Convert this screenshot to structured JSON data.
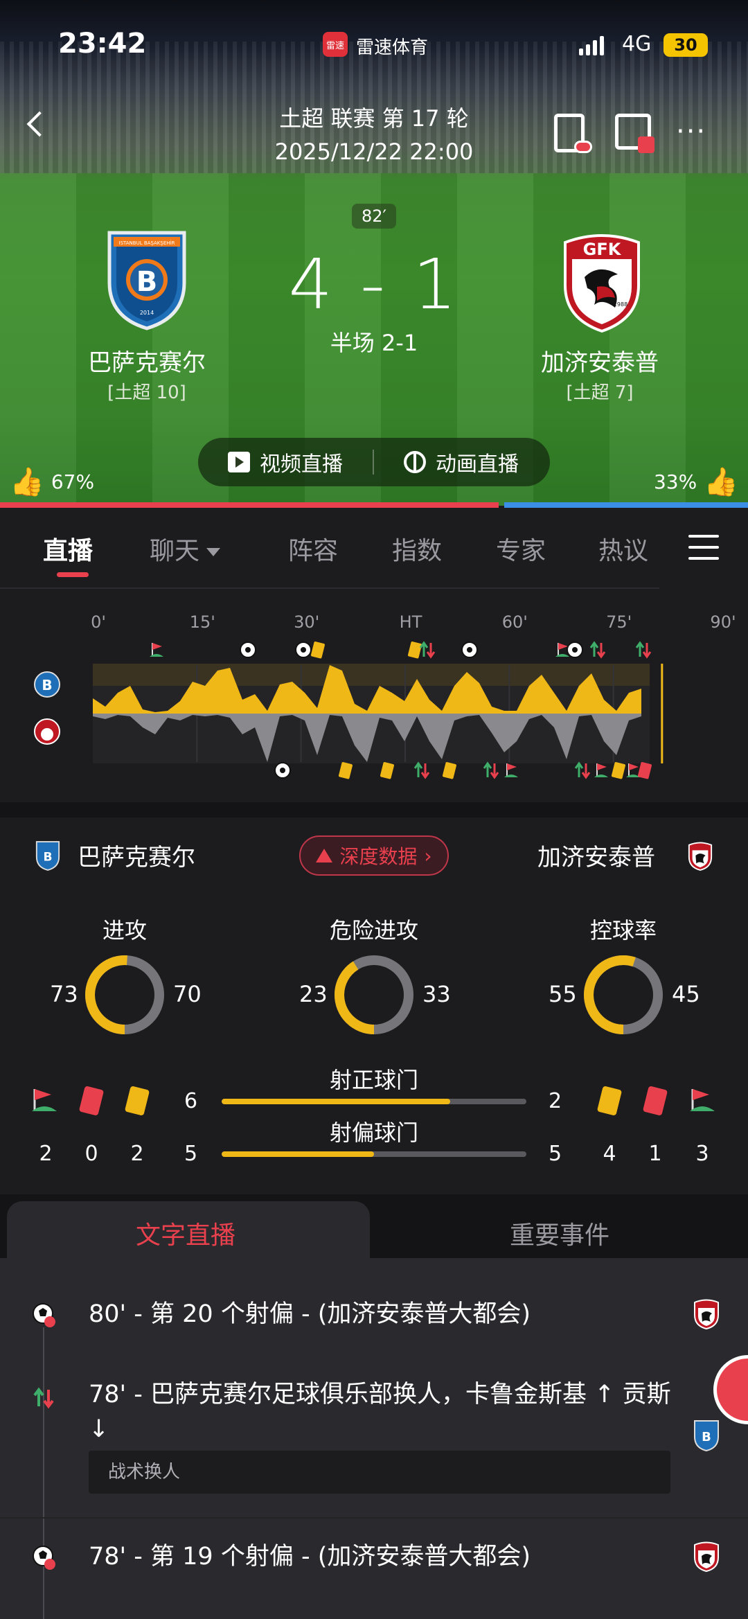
{
  "status": {
    "time": "23:42",
    "app_badge": "雷速",
    "app_name": "雷速体育",
    "network": "4G",
    "battery": "30"
  },
  "header": {
    "league_round": "土超 联赛 第 17 轮",
    "datetime": "2025/12/22 22:00"
  },
  "match": {
    "minute": "82′",
    "score": "4 - 1",
    "halftime": "半场 2-1",
    "home": {
      "name": "巴萨克赛尔",
      "rank": "[土超 10]",
      "crest_text": "B",
      "crest_banner": "ISTANBUL BAŞAKŞEHİR",
      "crest_year": "2014"
    },
    "away": {
      "name": "加济安泰普",
      "rank": "[土超 7]",
      "crest_text": "GFK",
      "crest_year": "1988"
    }
  },
  "live_buttons": {
    "video": "视频直播",
    "animation": "动画直播"
  },
  "votes": {
    "home_pct": "67%",
    "away_pct": "33%",
    "home_frac": 0.67
  },
  "tabs": [
    "直播",
    "聊天",
    "阵容",
    "指数",
    "专家",
    "热议"
  ],
  "timeline": {
    "ticks": [
      "0'",
      "15'",
      "30'",
      "HT",
      "60'",
      "75'",
      "90'"
    ],
    "current_minute": 82,
    "colors": {
      "home": "#f0b817",
      "away": "#8a8a8e"
    }
  },
  "stats": {
    "home_name": "巴萨克赛尔",
    "away_name": "加济安泰普",
    "deep_data": "深度数据",
    "donuts": [
      {
        "title": "进攻",
        "home": 73,
        "away": 70
      },
      {
        "title": "危险进攻",
        "home": 23,
        "away": 33
      },
      {
        "title": "控球率",
        "home": 55,
        "away": 45
      }
    ],
    "bars": [
      {
        "title": "射正球门",
        "home": 6,
        "away": 2
      },
      {
        "title": "射偏球门",
        "home": 5,
        "away": 5
      }
    ],
    "home_counts": {
      "corners": "2",
      "red": "0",
      "yellow": "2"
    },
    "away_counts": {
      "yellow": "4",
      "red": "1",
      "corners": "3"
    },
    "colors": {
      "home": "#f0b817",
      "away": "#76767a",
      "red_card": "#e9404e",
      "yellow_card": "#f0b817"
    }
  },
  "bottom_tabs": {
    "text_live": "文字直播",
    "key_events": "重要事件"
  },
  "feed": [
    {
      "text": "80' - 第 20 个射偏 - (加济安泰普大都会)",
      "team": "away",
      "icon": "miss-shot-icon"
    },
    {
      "text": "78' - 巴萨克赛尔足球俱乐部换人，卡鲁金斯基 ↑ 贡斯 ↓",
      "sub": "战术换人",
      "team": "home",
      "icon": "substitution-icon"
    },
    {
      "text": "78' - 第 19 个射偏 - (加济安泰普大都会)",
      "team": "away",
      "icon": "miss-shot-icon"
    }
  ]
}
